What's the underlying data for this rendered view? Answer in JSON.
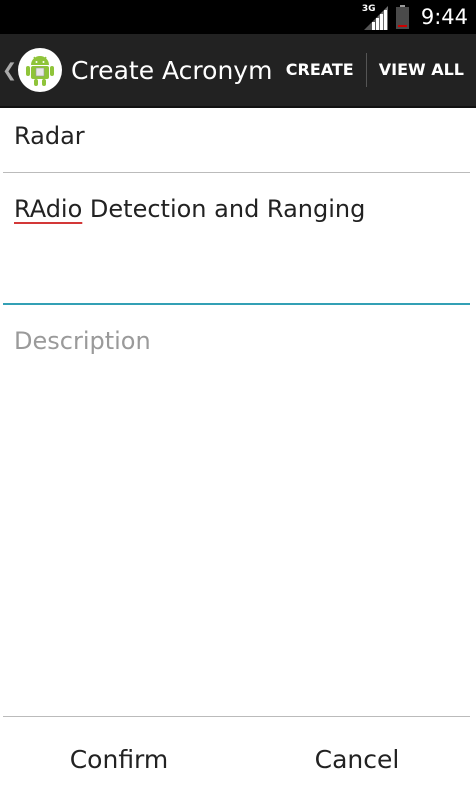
{
  "status_bar": {
    "network": "3G",
    "time": "9:44",
    "battery_level": 0.1
  },
  "action_bar": {
    "title": "Create Acronym",
    "actions": [
      "CREATE",
      "VIEW ALL"
    ],
    "icon": "android-robot-icon",
    "up_icon": "chevron-left-icon"
  },
  "form": {
    "acronym_value": "Radar",
    "meaning_misspelled": "RAdio",
    "meaning_rest": " Detection and Ranging",
    "description_placeholder": "Description"
  },
  "buttons": {
    "confirm": "Confirm",
    "cancel": "Cancel"
  },
  "colors": {
    "focus_underline": "#33a0b5",
    "spellcheck_underline": "#d33838",
    "action_bar": "#222222"
  }
}
